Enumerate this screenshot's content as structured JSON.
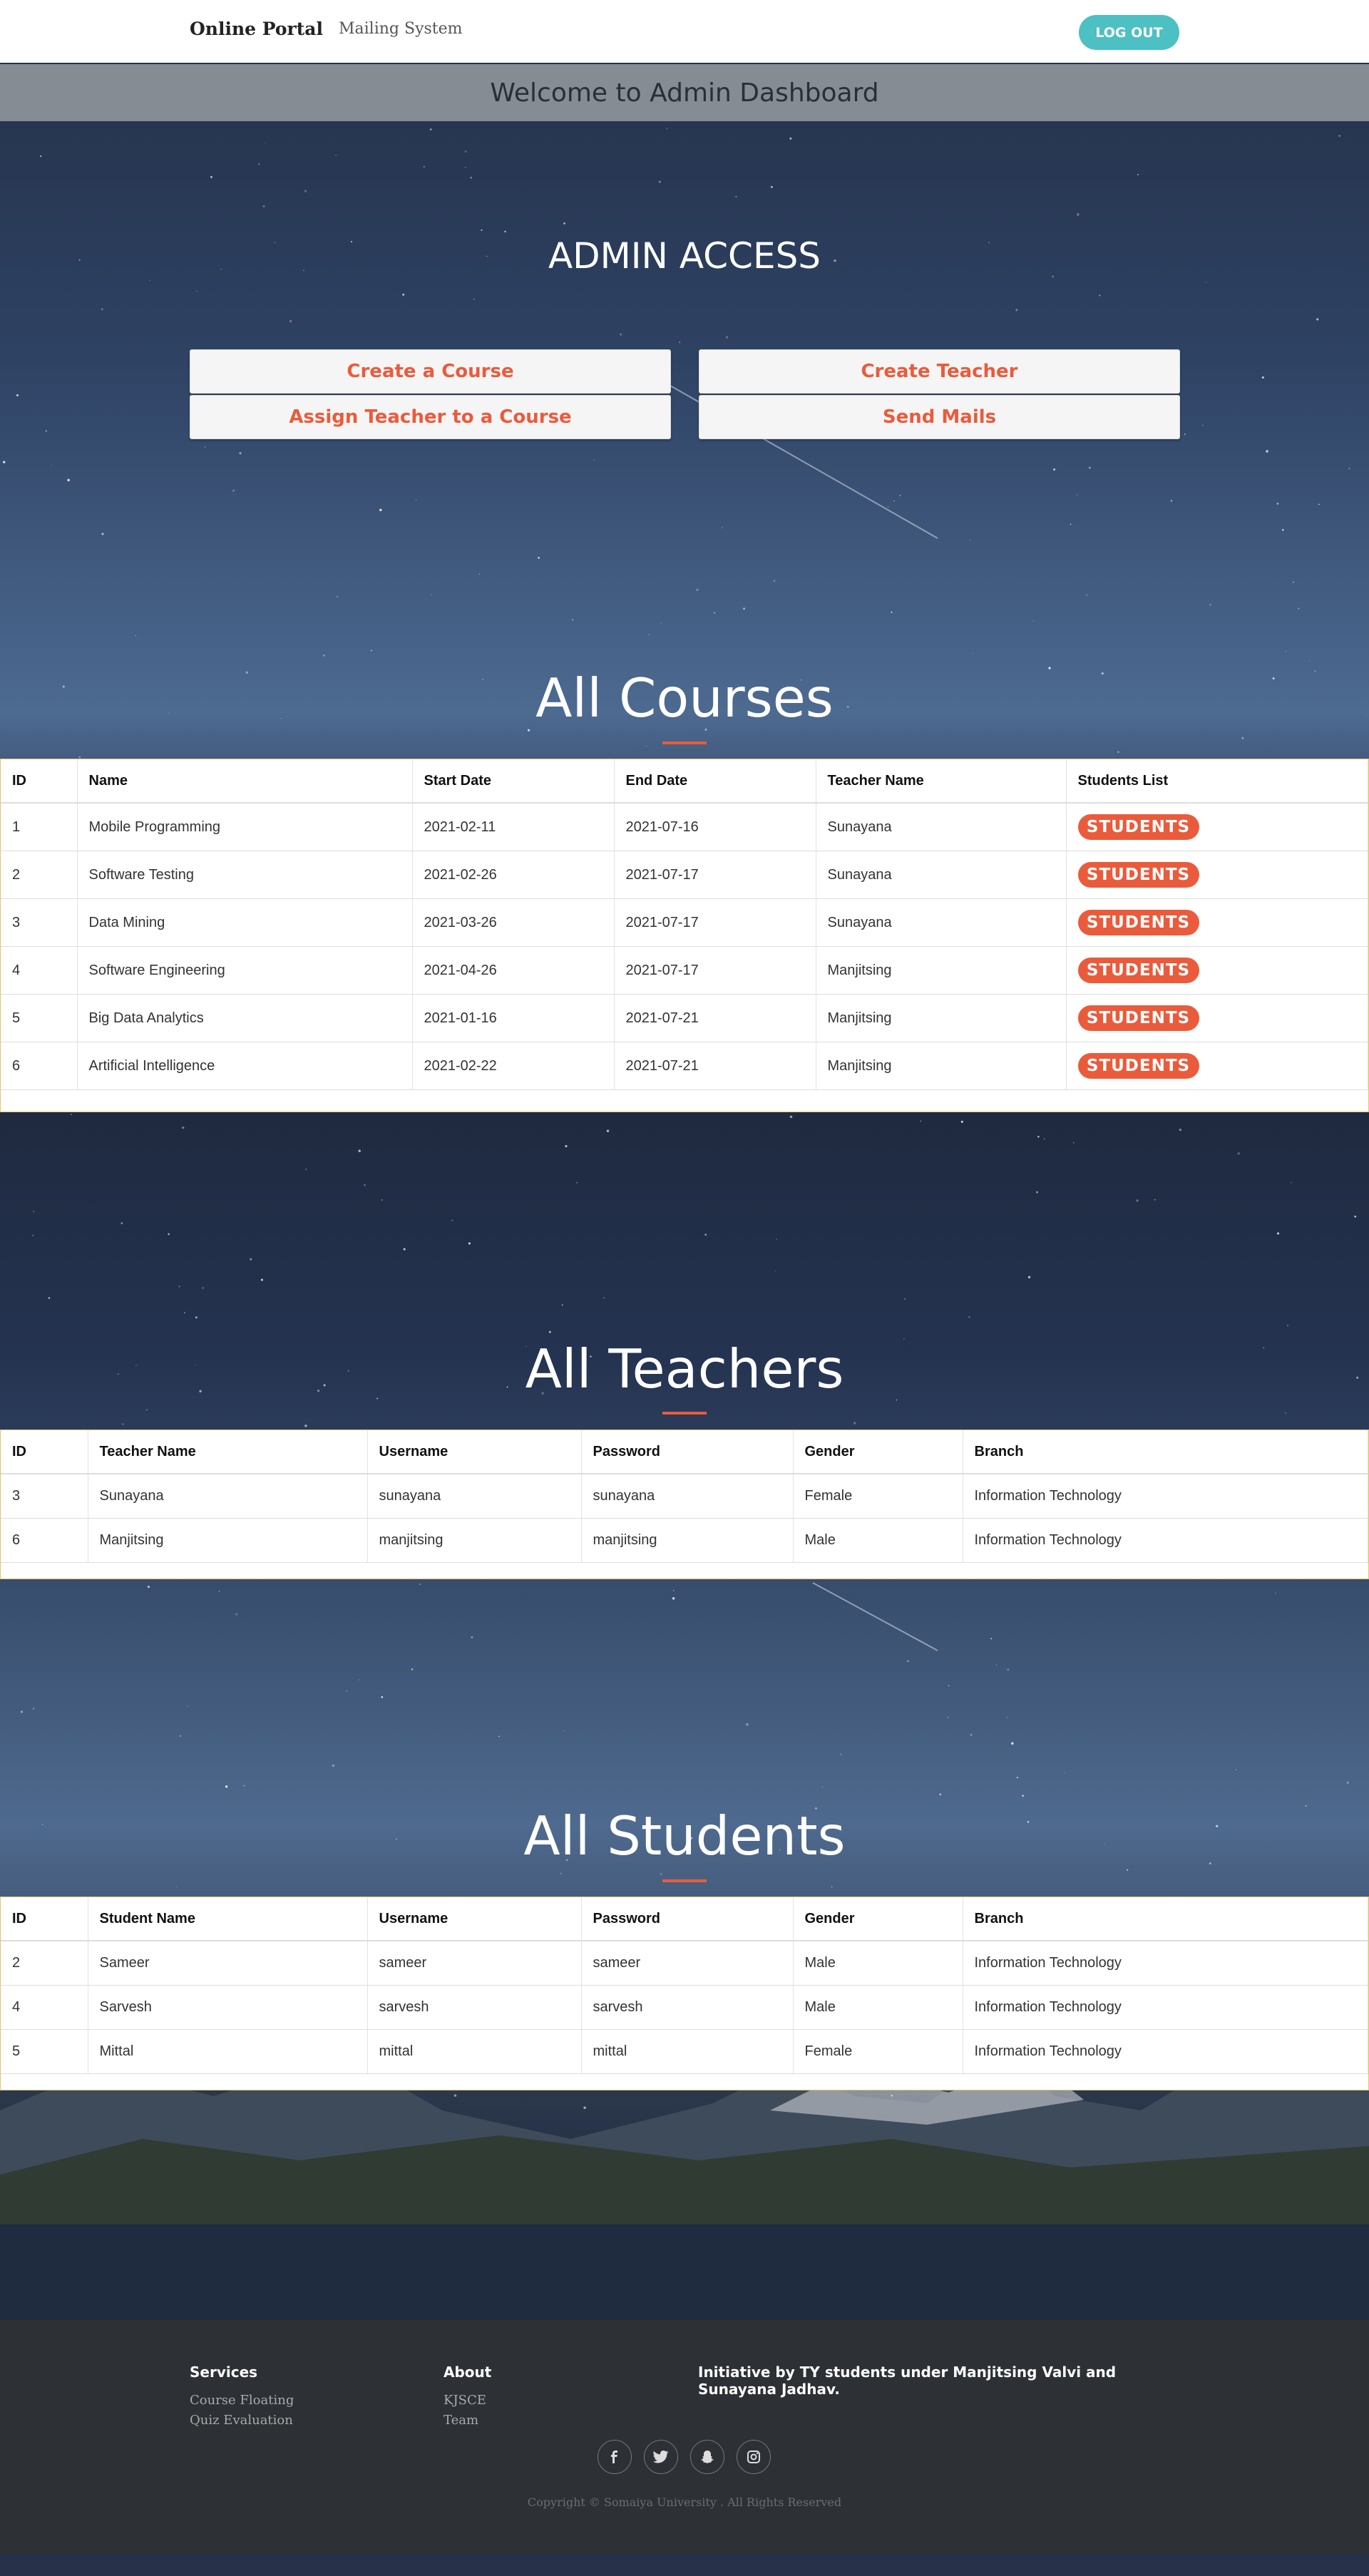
{
  "navbar": {
    "brand": "Online Portal",
    "link": "Mailing System",
    "logout": "LOG OUT"
  },
  "banner": {
    "welcome": "Welcome to Admin Dashboard"
  },
  "admin": {
    "title": "ADMIN ACCESS",
    "buttons": [
      "Create a Course",
      "Create Teacher",
      "Assign Teacher to a Course",
      "Send Mails"
    ]
  },
  "courses": {
    "title": "All Courses",
    "headers": [
      "ID",
      "Name",
      "Start Date",
      "End Date",
      "Teacher Name",
      "Students List"
    ],
    "button_label": "STUDENTS",
    "rows": [
      [
        "1",
        "Mobile Programming",
        "2021-02-11",
        "2021-07-16",
        "Sunayana"
      ],
      [
        "2",
        "Software Testing",
        "2021-02-26",
        "2021-07-17",
        "Sunayana"
      ],
      [
        "3",
        "Data Mining",
        "2021-03-26",
        "2021-07-17",
        "Sunayana"
      ],
      [
        "4",
        "Software Engineering",
        "2021-04-26",
        "2021-07-17",
        "Manjitsing"
      ],
      [
        "5",
        "Big Data Analytics",
        "2021-01-16",
        "2021-07-21",
        "Manjitsing"
      ],
      [
        "6",
        "Artificial Intelligence",
        "2021-02-22",
        "2021-07-21",
        "Manjitsing"
      ]
    ]
  },
  "teachers": {
    "title": "All Teachers",
    "headers": [
      "ID",
      "Teacher Name",
      "Username",
      "Password",
      "Gender",
      "Branch"
    ],
    "rows": [
      [
        "3",
        "Sunayana",
        "sunayana",
        "sunayana",
        "Female",
        "Information Technology"
      ],
      [
        "6",
        "Manjitsing",
        "manjitsing",
        "manjitsing",
        "Male",
        "Information Technology"
      ]
    ]
  },
  "students": {
    "title": "All Students",
    "headers": [
      "ID",
      "Student Name",
      "Username",
      "Password",
      "Gender",
      "Branch"
    ],
    "rows": [
      [
        "2",
        "Sameer",
        "sameer",
        "sameer",
        "Male",
        "Information Technology"
      ],
      [
        "4",
        "Sarvesh",
        "sarvesh",
        "sarvesh",
        "Male",
        "Information Technology"
      ],
      [
        "5",
        "Mittal",
        "mittal",
        "mittal",
        "Female",
        "Information Technology"
      ]
    ]
  },
  "footer": {
    "services_title": "Services",
    "services": [
      "Course Floating",
      "Quiz Evaluation"
    ],
    "about_title": "About",
    "about": [
      "KJSCE",
      "Team"
    ],
    "initiative": "Initiative by TY students under Manjitsing Valvi and Sunayana Jadhav.",
    "social_icons": [
      "facebook-icon",
      "twitter-icon",
      "snapchat-icon",
      "instagram-icon"
    ],
    "copyright": "Copyright © Somaiya University . All Rights Reserved"
  },
  "colors": {
    "accent": "#ea5b3c",
    "logout": "#4cc0c2",
    "table_border": "#e5c36b",
    "footer": "#2d3035"
  }
}
